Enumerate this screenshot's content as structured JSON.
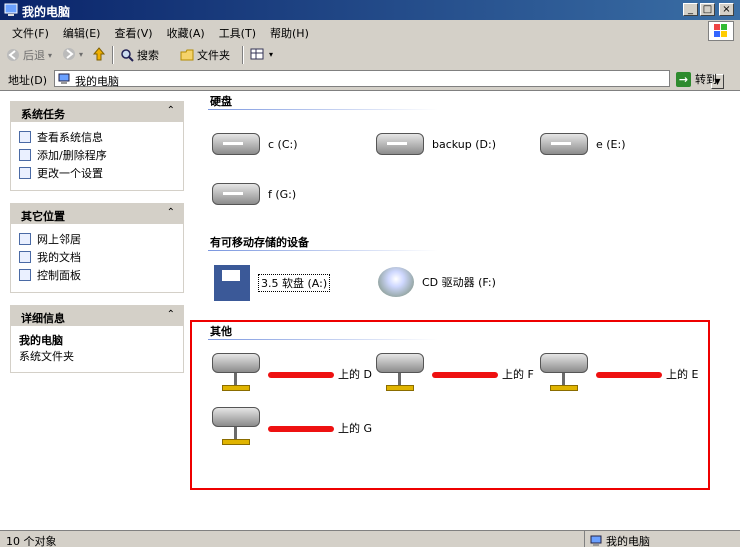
{
  "window": {
    "title": "我的电脑"
  },
  "menu": [
    "文件(F)",
    "编辑(E)",
    "查看(V)",
    "收藏(A)",
    "工具(T)",
    "帮助(H)"
  ],
  "toolbar": {
    "back": "后退",
    "search": "搜索",
    "folders": "文件夹",
    "view_icon": "views-icon"
  },
  "address": {
    "label": "地址(D)",
    "value": "我的电脑",
    "go": "转到"
  },
  "panels": {
    "system_tasks": {
      "title": "系统任务",
      "items": [
        "查看系统信息",
        "添加/删除程序",
        "更改一个设置"
      ]
    },
    "other_places": {
      "title": "其它位置",
      "items": [
        "网上邻居",
        "我的文档",
        "控制面板"
      ]
    },
    "details": {
      "title": "详细信息",
      "name": "我的电脑",
      "desc": "系统文件夹"
    }
  },
  "sections": {
    "hard_disks": {
      "title": "硬盘",
      "items": [
        "c (C:)",
        "backup (D:)",
        "e (E:)",
        "f (G:)"
      ]
    },
    "removable": {
      "title": "有可移动存储的设备",
      "items": [
        "3.5 软盘 (A:)",
        "CD 驱动器 (F:)"
      ]
    },
    "other": {
      "title": "其他",
      "items": [
        "上的 D",
        "上的 F",
        "上的 E",
        "上的 G"
      ]
    }
  },
  "status": {
    "count": "10 个对象",
    "location": "我的电脑"
  },
  "colors": {
    "highlight": "#e00000"
  }
}
